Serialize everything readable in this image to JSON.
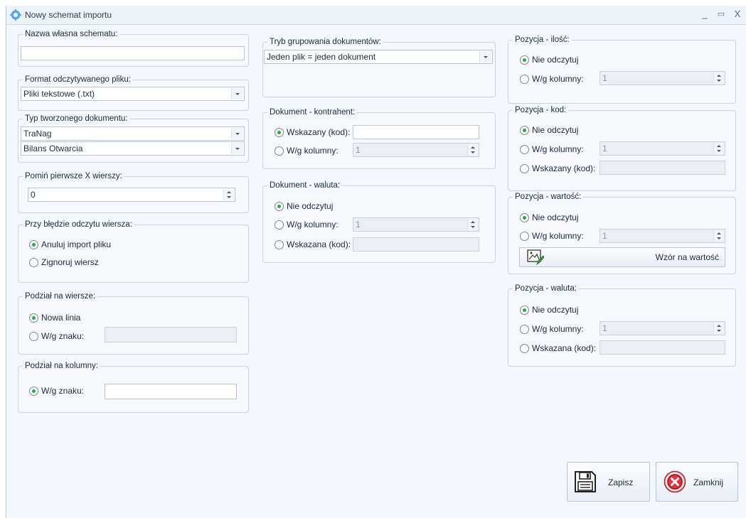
{
  "window": {
    "title": "Nowy schemat importu",
    "minimize": "_",
    "maximize": "▭",
    "close": "X"
  },
  "colors": {
    "accent": "#2aa548",
    "close_icon": "#d9363e"
  },
  "schema_name": {
    "label": "Nazwa własna schematu:",
    "value": ""
  },
  "file_format": {
    "label": "Format odczytywanego pliku:",
    "value": "Pliki tekstowe (.txt)"
  },
  "doc_type": {
    "label": "Typ tworzonego dokumentu:",
    "value1": "TraNag",
    "value2": "Bilans Otwarcia"
  },
  "skip_rows": {
    "label": "Pomiń pierwsze X wierszy:",
    "value": "0"
  },
  "row_error": {
    "label": "Przy błędzie odczytu wiersza:",
    "opt1": "Anuluj import pliku",
    "opt2": "Zignoruj wiersz"
  },
  "row_split": {
    "label": "Podział na wiersze:",
    "opt1": "Nowa linia",
    "opt2": "W/g znaku:",
    "value": ""
  },
  "col_split": {
    "label": "Podział na kolumny:",
    "opt1": "W/g znaku:",
    "value": ""
  },
  "grouping": {
    "label": "Tryb grupowania dokumentów:",
    "value": "Jeden plik = jeden dokument"
  },
  "contractor": {
    "label": "Dokument - kontrahent:",
    "opt1": "Wskazany (kod):",
    "opt2": "W/g kolumny:",
    "code_value": "",
    "col_value": "1"
  },
  "currency": {
    "label": "Dokument - waluta:",
    "opt1": "Nie odczytuj",
    "opt2": "W/g kolumny:",
    "opt3": "Wskazana (kod):",
    "col_value": "1",
    "code_value": ""
  },
  "qty": {
    "label": "Pozycja - ilość:",
    "opt1": "Nie odczytuj",
    "opt2": "W/g kolumny:",
    "col_value": "1"
  },
  "code": {
    "label": "Pozycja - kod:",
    "opt1": "Nie odczytuj",
    "opt2": "W/g kolumny:",
    "opt3": "Wskazany (kod):",
    "col_value": "1",
    "code_value": ""
  },
  "value": {
    "label": "Pozycja - wartość:",
    "opt1": "Nie odczytuj",
    "opt2": "W/g kolumny:",
    "col_value": "1",
    "formula_button": "Wzór na wartość"
  },
  "pos_currency": {
    "label": "Pozycja - waluta:",
    "opt1": "Nie odczytuj",
    "opt2": "W/g kolumny:",
    "opt3": "Wskazana (kod):",
    "col_value": "1",
    "code_value": ""
  },
  "actions": {
    "save": "Zapisz",
    "close": "Zamknij"
  }
}
